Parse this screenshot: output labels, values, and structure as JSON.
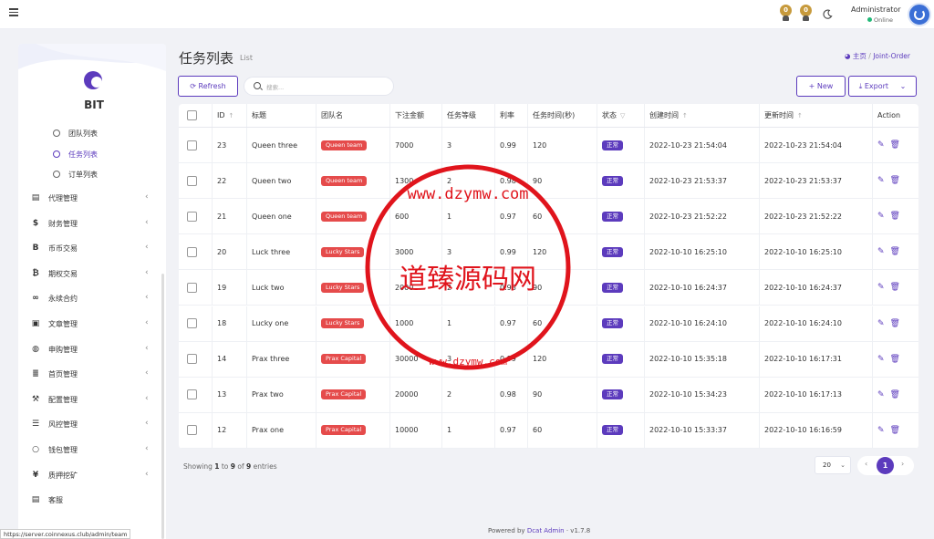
{
  "header": {
    "notif_1": "0",
    "notif_2": "0",
    "user_name": "Administrator",
    "user_status": "Online"
  },
  "sidebar": {
    "brand": "BIT",
    "sub_items": [
      {
        "label": "团队列表",
        "active": false
      },
      {
        "label": "任务列表",
        "active": true
      },
      {
        "label": "订单列表",
        "active": false
      }
    ],
    "items": [
      {
        "icon": "agent-card-icon",
        "glyph": "▤",
        "label": "代理管理",
        "chevron": true
      },
      {
        "icon": "dollar-icon",
        "glyph": "$",
        "label": "财务管理",
        "chevron": true
      },
      {
        "icon": "b-letter-icon",
        "glyph": "B",
        "label": "币币交易",
        "chevron": true
      },
      {
        "icon": "bitcoin-icon",
        "glyph": "₿",
        "label": "期权交易",
        "chevron": true
      },
      {
        "icon": "link-icon",
        "glyph": "∞",
        "label": "永续合约",
        "chevron": true
      },
      {
        "icon": "newspaper-icon",
        "glyph": "▣",
        "label": "文章管理",
        "chevron": true
      },
      {
        "icon": "globe-icon",
        "glyph": "◍",
        "label": "申购管理",
        "chevron": true
      },
      {
        "icon": "list-icon",
        "glyph": "≣",
        "label": "首页管理",
        "chevron": true
      },
      {
        "icon": "wrench-icon",
        "glyph": "⚒",
        "label": "配置管理",
        "chevron": true
      },
      {
        "icon": "list-detail-icon",
        "glyph": "☰",
        "label": "风控管理",
        "chevron": true
      },
      {
        "icon": "circle-icon",
        "glyph": "○",
        "label": "钱包管理",
        "chevron": true
      },
      {
        "icon": "yen-icon",
        "glyph": "¥",
        "label": "质押挖矿",
        "chevron": true
      },
      {
        "icon": "id-card-icon",
        "glyph": "▤",
        "label": "客服",
        "chevron": false
      }
    ]
  },
  "page": {
    "title": "任务列表",
    "subtitle": "List",
    "breadcrumb_home": "主页",
    "breadcrumb_sep": "/",
    "breadcrumb_current": "Joint-Order"
  },
  "toolbar": {
    "refresh_label": "Refresh",
    "search_placeholder": "搜索...",
    "new_label": "New",
    "export_label": "Export"
  },
  "table": {
    "headers": {
      "id": "ID",
      "title": "标题",
      "team": "团队名",
      "amount": "下注金额",
      "level": "任务等级",
      "rate": "利率",
      "time": "任务时间(秒)",
      "status": "状态",
      "created": "创建时间",
      "updated": "更新时间",
      "action": "Action"
    },
    "rows": [
      {
        "id": "23",
        "title": "Queen three",
        "team": "Queen team",
        "amount": "7000",
        "level": "3",
        "rate": "0.99",
        "time": "120",
        "status": "正常",
        "created": "2022-10-23 21:54:04",
        "updated": "2022-10-23 21:54:04"
      },
      {
        "id": "22",
        "title": "Queen two",
        "team": "Queen team",
        "amount": "1300",
        "level": "2",
        "rate": "0.98",
        "time": "90",
        "status": "正常",
        "created": "2022-10-23 21:53:37",
        "updated": "2022-10-23 21:53:37"
      },
      {
        "id": "21",
        "title": "Queen one",
        "team": "Queen team",
        "amount": "600",
        "level": "1",
        "rate": "0.97",
        "time": "60",
        "status": "正常",
        "created": "2022-10-23 21:52:22",
        "updated": "2022-10-23 21:52:22"
      },
      {
        "id": "20",
        "title": "Luck three",
        "team": "Lucky Stars",
        "amount": "3000",
        "level": "3",
        "rate": "0.99",
        "time": "120",
        "status": "正常",
        "created": "2022-10-10 16:25:10",
        "updated": "2022-10-10 16:25:10"
      },
      {
        "id": "19",
        "title": "Luck two",
        "team": "Lucky Stars",
        "amount": "2000",
        "level": "2",
        "rate": "0.98",
        "time": "90",
        "status": "正常",
        "created": "2022-10-10 16:24:37",
        "updated": "2022-10-10 16:24:37"
      },
      {
        "id": "18",
        "title": "Lucky one",
        "team": "Lucky Stars",
        "amount": "1000",
        "level": "1",
        "rate": "0.97",
        "time": "60",
        "status": "正常",
        "created": "2022-10-10 16:24:10",
        "updated": "2022-10-10 16:24:10"
      },
      {
        "id": "14",
        "title": "Prax three",
        "team": "Prax Capital",
        "amount": "30000",
        "level": "3",
        "rate": "0.99",
        "time": "120",
        "status": "正常",
        "created": "2022-10-10 15:35:18",
        "updated": "2022-10-10 16:17:31"
      },
      {
        "id": "13",
        "title": "Prax two",
        "team": "Prax Capital",
        "amount": "20000",
        "level": "2",
        "rate": "0.98",
        "time": "90",
        "status": "正常",
        "created": "2022-10-10 15:34:23",
        "updated": "2022-10-10 16:17:13"
      },
      {
        "id": "12",
        "title": "Prax one",
        "team": "Prax Capital",
        "amount": "10000",
        "level": "1",
        "rate": "0.97",
        "time": "60",
        "status": "正常",
        "created": "2022-10-10 15:33:37",
        "updated": "2022-10-10 16:16:59"
      }
    ]
  },
  "pagination": {
    "showing_prefix": "Showing",
    "from": "1",
    "to_word": "to",
    "to": "9",
    "of_word": "of",
    "total": "9",
    "entries_word": "entries",
    "per_page": "20",
    "current_page": "1"
  },
  "footer": {
    "powered_by": "Powered by",
    "powered_link": "Dcat Admin",
    "version": "· v1.7.8"
  },
  "status_url": "https://server.coinnexus.club/admin/team",
  "watermark": {
    "title": "道臻源码网",
    "url_text": "www.dzymw.com"
  },
  "colors": {
    "accent": "#5c3bbd",
    "team_badge": "#e54b4b",
    "watermark": "#e0141c"
  }
}
